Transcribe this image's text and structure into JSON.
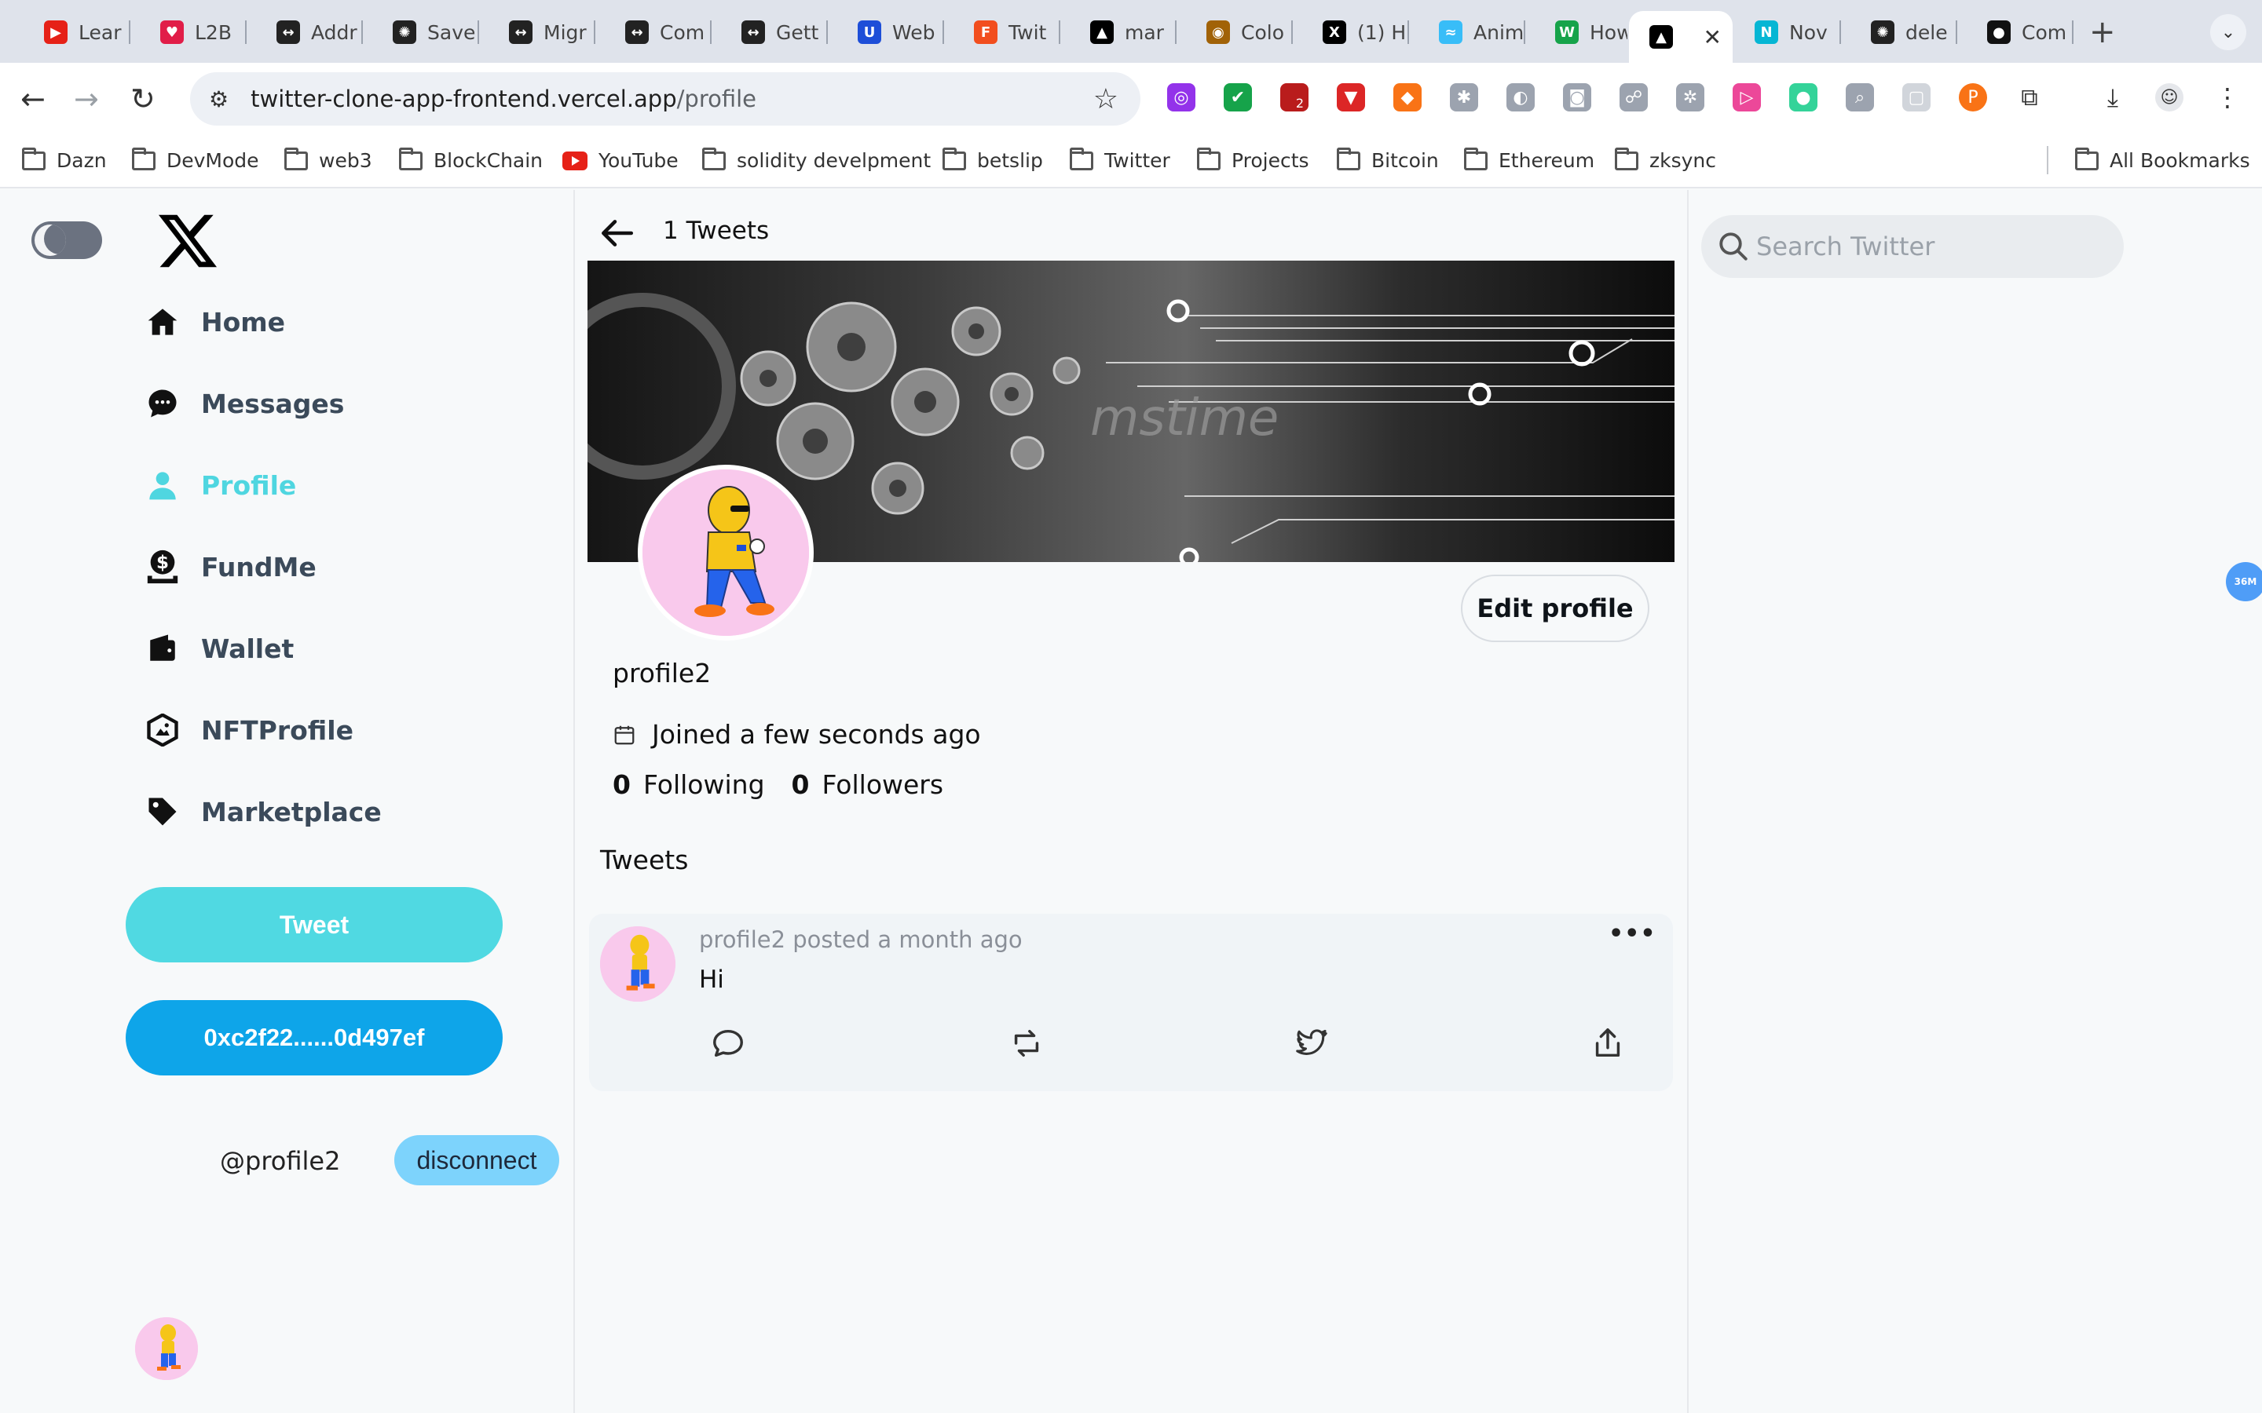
{
  "browser": {
    "tabs": [
      {
        "label": "Lear",
        "fav_color": "#e62117"
      },
      {
        "label": "L2B",
        "fav_color": "#e11d48"
      },
      {
        "label": "Addr",
        "fav_color": "#222222"
      },
      {
        "label": "Save",
        "fav_color": "#222222"
      },
      {
        "label": "Migr",
        "fav_color": "#222222"
      },
      {
        "label": "Com",
        "fav_color": "#222222"
      },
      {
        "label": "Gett",
        "fav_color": "#222222"
      },
      {
        "label": "Web",
        "fav_color": "#1d4ed8"
      },
      {
        "label": "Twit",
        "fav_color": "#f24e1e"
      },
      {
        "label": "mar",
        "fav_color": "#000000"
      },
      {
        "label": "Colo",
        "fav_color": "#a16207"
      },
      {
        "label": "(1) H",
        "fav_color": "#000000"
      },
      {
        "label": "Anim",
        "fav_color": "#38bdf8"
      },
      {
        "label": "How",
        "fav_color": "#16a34a"
      },
      {
        "label": "",
        "fav_color": "#000000"
      },
      {
        "label": "Nov",
        "fav_color": "#06b6d4"
      },
      {
        "label": "dele",
        "fav_color": "#222222"
      },
      {
        "label": "Com",
        "fav_color": "#111111"
      }
    ],
    "url_host": "twitter-clone-app-frontend.vercel.app",
    "url_path": "/profile",
    "bookmarks": [
      "Dazn",
      "DevMode",
      "web3",
      "BlockChain",
      "YouTube",
      "solidity develpment",
      "betslip",
      "Twitter",
      "Projects",
      "Bitcoin",
      "Ethereum",
      "zksync"
    ],
    "all_bookmarks": "All Bookmarks",
    "extension_badge": "2"
  },
  "sidebar": {
    "items": [
      {
        "label": "Home",
        "icon": "home-icon"
      },
      {
        "label": "Messages",
        "icon": "chat-icon"
      },
      {
        "label": "Profile",
        "icon": "user-icon",
        "active": true
      },
      {
        "label": "FundMe",
        "icon": "dollar-icon"
      },
      {
        "label": "Wallet",
        "icon": "wallet-icon"
      },
      {
        "label": "NFTProfile",
        "icon": "nft-icon"
      },
      {
        "label": "Marketplace",
        "icon": "tag-icon"
      }
    ],
    "tweet_button": "Tweet",
    "wallet_address": "0xc2f22......0d497ef",
    "user_handle": "@profile2",
    "disconnect": "disconnect",
    "accent_color": "#4fd6e0"
  },
  "profile": {
    "tweet_count_label": "1 Tweets",
    "banner_watermark": "mstime",
    "edit_button": "Edit profile",
    "name": "profile2",
    "joined": "Joined a few seconds ago",
    "following_count": "0",
    "following_label": "Following",
    "followers_count": "0",
    "followers_label": "Followers",
    "tweets_heading": "Tweets"
  },
  "tweets": [
    {
      "meta": "profile2 posted a month ago",
      "text": "Hi",
      "more": "•••"
    }
  ],
  "search": {
    "placeholder": "Search Twitter"
  },
  "side_bubble": "36M"
}
